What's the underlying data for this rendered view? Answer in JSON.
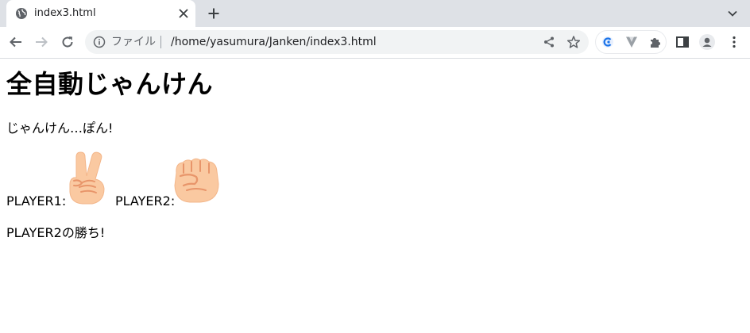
{
  "browser": {
    "tab": {
      "title": "index3.html",
      "favicon": "globe-icon"
    },
    "address": {
      "scheme_label": "ファイル",
      "url": "/home/yasumura/Janken/index3.html"
    }
  },
  "page": {
    "title": "全自動じゃんけん",
    "status": "じゃんけん…ぽん!",
    "player1": {
      "label": "PLAYER1:",
      "hand": "scissors-hand-icon"
    },
    "player2": {
      "label": "PLAYER2:",
      "hand": "rock-hand-icon"
    },
    "result": "PLAYER2の勝ち!"
  },
  "colors": {
    "tabstrip_bg": "#dee1e6",
    "omnibox_bg": "#f1f3f4",
    "hand_skin": "#fac9a1",
    "hand_line": "#e8956a"
  }
}
